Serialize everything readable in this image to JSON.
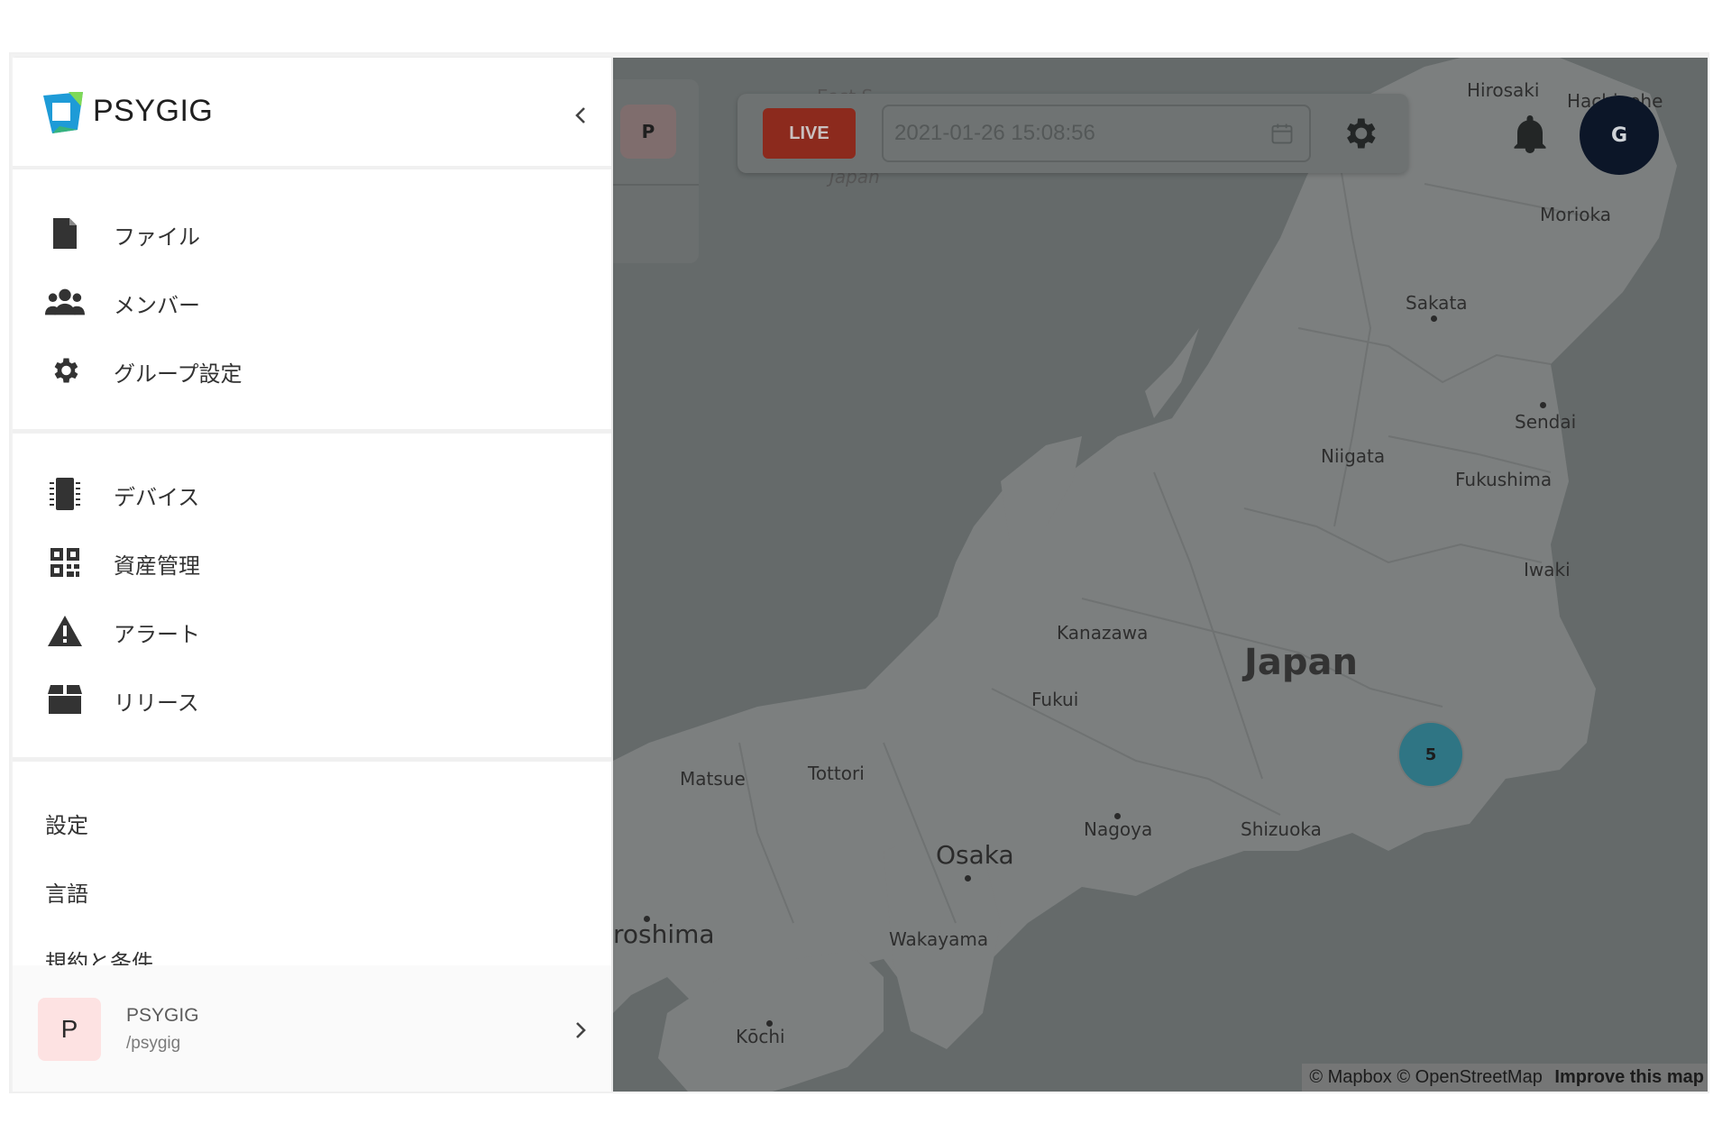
{
  "brand": {
    "name": "PSYGIG"
  },
  "nav": {
    "group1": [
      {
        "label": "ファイル",
        "icon": "file-icon"
      },
      {
        "label": "メンバー",
        "icon": "users-icon"
      },
      {
        "label": "グループ設定",
        "icon": "gear-icon"
      }
    ],
    "group2": [
      {
        "label": "デバイス",
        "icon": "chip-icon"
      },
      {
        "label": "資産管理",
        "icon": "qr-code-icon"
      },
      {
        "label": "アラート",
        "icon": "warning-icon"
      },
      {
        "label": "リリース",
        "icon": "box-icon"
      }
    ],
    "group3": [
      {
        "label": "設定"
      },
      {
        "label": "言語"
      },
      {
        "label": "規約と条件"
      }
    ]
  },
  "org": {
    "avatar_letter": "P",
    "name": "PSYGIG",
    "slug": "/psygig"
  },
  "group_card": {
    "avatar_letter": "P"
  },
  "toolbar": {
    "live_label": "LIVE",
    "datetime": "2021-01-26 15:08:56",
    "calendar_icon": "calendar-icon",
    "settings_icon": "gear-icon"
  },
  "header": {
    "bell_icon": "bell-icon",
    "user_avatar_letter": "G"
  },
  "map": {
    "labels": {
      "hirosaki": "Hirosaki",
      "hachinohe": "Hachinohe",
      "morioka": "Morioka",
      "sakata": "Sakata",
      "sendai": "Sendai",
      "niigata": "Niigata",
      "fukushima": "Fukushima",
      "iwaki": "Iwaki",
      "kanazawa": "Kanazawa",
      "japan": "Japan",
      "fukui": "Fukui",
      "matsue": "Matsue",
      "tottori": "Tottori",
      "osaka": "Osaka",
      "nagoya": "Nagoya",
      "shizuoka": "Shizuoka",
      "hiroshima": "roshima",
      "wakayama": "Wakayama",
      "kochi": "Kōchi",
      "sea_top_1": "East S",
      "sea_top_2": "Japan"
    },
    "cluster_count": "5",
    "attribution": {
      "mapbox": "© Mapbox",
      "osm": "© OpenStreetMap",
      "improve": "Improve this map"
    }
  },
  "colors": {
    "sidebar_bg": "#ffffff",
    "map_water": "#656a6a",
    "map_land": "#7f8282",
    "live_bg": "#8c2a1d",
    "cluster": "#2f7584",
    "avatar_bg": "#0c1628"
  }
}
